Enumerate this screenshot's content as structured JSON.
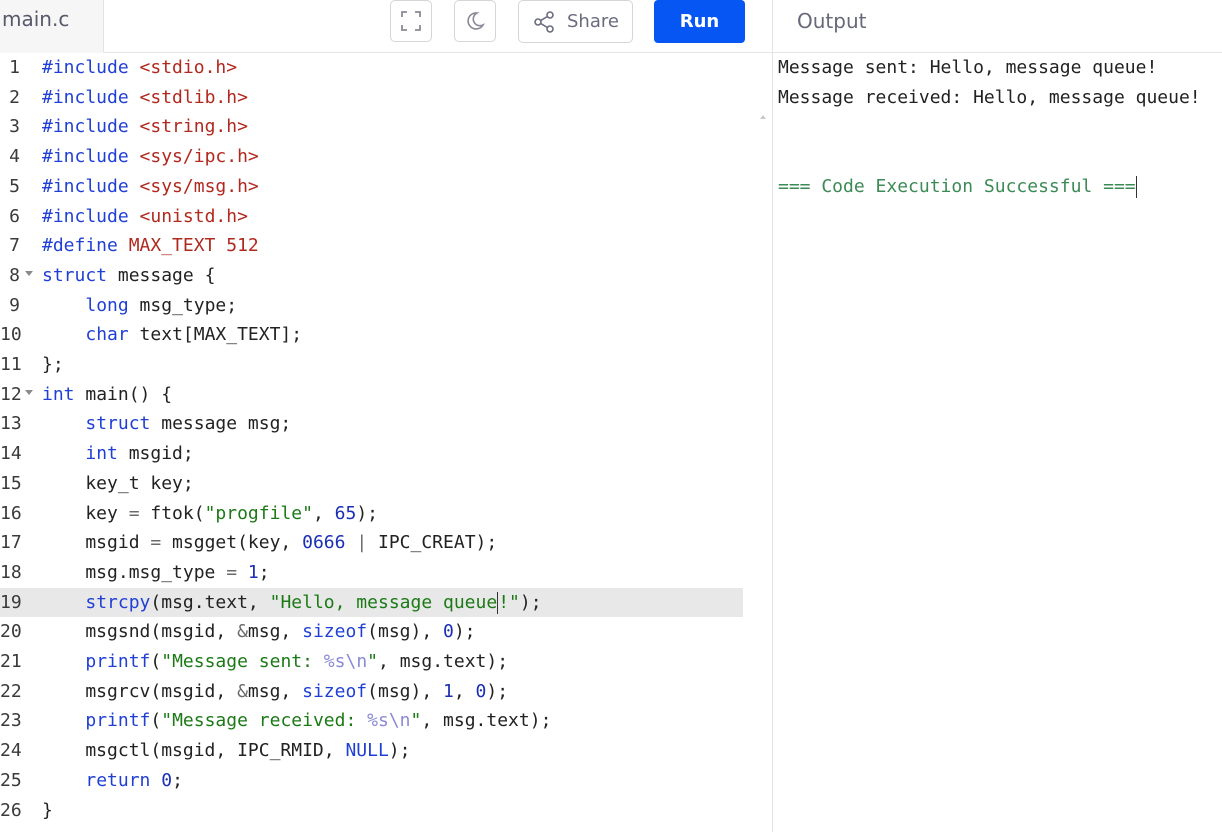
{
  "file_tab": {
    "name": "main.c"
  },
  "toolbar": {
    "share_label": "Share",
    "run_label": "Run"
  },
  "output_panel": {
    "title": "Output",
    "lines": [
      "Message sent: Hello, message queue!",
      "Message received: Hello, message queue!"
    ],
    "status": "=== Code Execution Successful ==="
  },
  "editor": {
    "active_line": 19,
    "lines": [
      {
        "n": "1",
        "t": "#include <stdio.h>"
      },
      {
        "n": "2",
        "t": "#include <stdlib.h>"
      },
      {
        "n": "3",
        "t": "#include <string.h>"
      },
      {
        "n": "4",
        "t": "#include <sys/ipc.h>"
      },
      {
        "n": "5",
        "t": "#include <sys/msg.h>"
      },
      {
        "n": "6",
        "t": "#include <unistd.h>"
      },
      {
        "n": "7",
        "t": "#define MAX_TEXT 512"
      },
      {
        "n": "8",
        "t": "struct message {"
      },
      {
        "n": "9",
        "t": "    long msg_type;"
      },
      {
        "n": "10",
        "t": "    char text[MAX_TEXT];"
      },
      {
        "n": "11",
        "t": "};"
      },
      {
        "n": "12",
        "t": "int main() {"
      },
      {
        "n": "13",
        "t": "    struct message msg;"
      },
      {
        "n": "14",
        "t": "    int msgid;"
      },
      {
        "n": "15",
        "t": "    key_t key;"
      },
      {
        "n": "16",
        "t": "    key = ftok(\"progfile\", 65);"
      },
      {
        "n": "17",
        "t": "    msgid = msgget(key, 0666 | IPC_CREAT);"
      },
      {
        "n": "18",
        "t": "    msg.msg_type = 1;"
      },
      {
        "n": "19",
        "t": "    strcpy(msg.text, \"Hello, message queue!\");"
      },
      {
        "n": "20",
        "t": "    msgsnd(msgid, &msg, sizeof(msg), 0);"
      },
      {
        "n": "21",
        "t": "    printf(\"Message sent: %s\\n\", msg.text);"
      },
      {
        "n": "22",
        "t": "    msgrcv(msgid, &msg, sizeof(msg), 1, 0);"
      },
      {
        "n": "23",
        "t": "    printf(\"Message received: %s\\n\", msg.text);"
      },
      {
        "n": "24",
        "t": "    msgctl(msgid, IPC_RMID, NULL);"
      },
      {
        "n": "25",
        "t": "    return 0;"
      },
      {
        "n": "26",
        "t": "}"
      }
    ]
  }
}
